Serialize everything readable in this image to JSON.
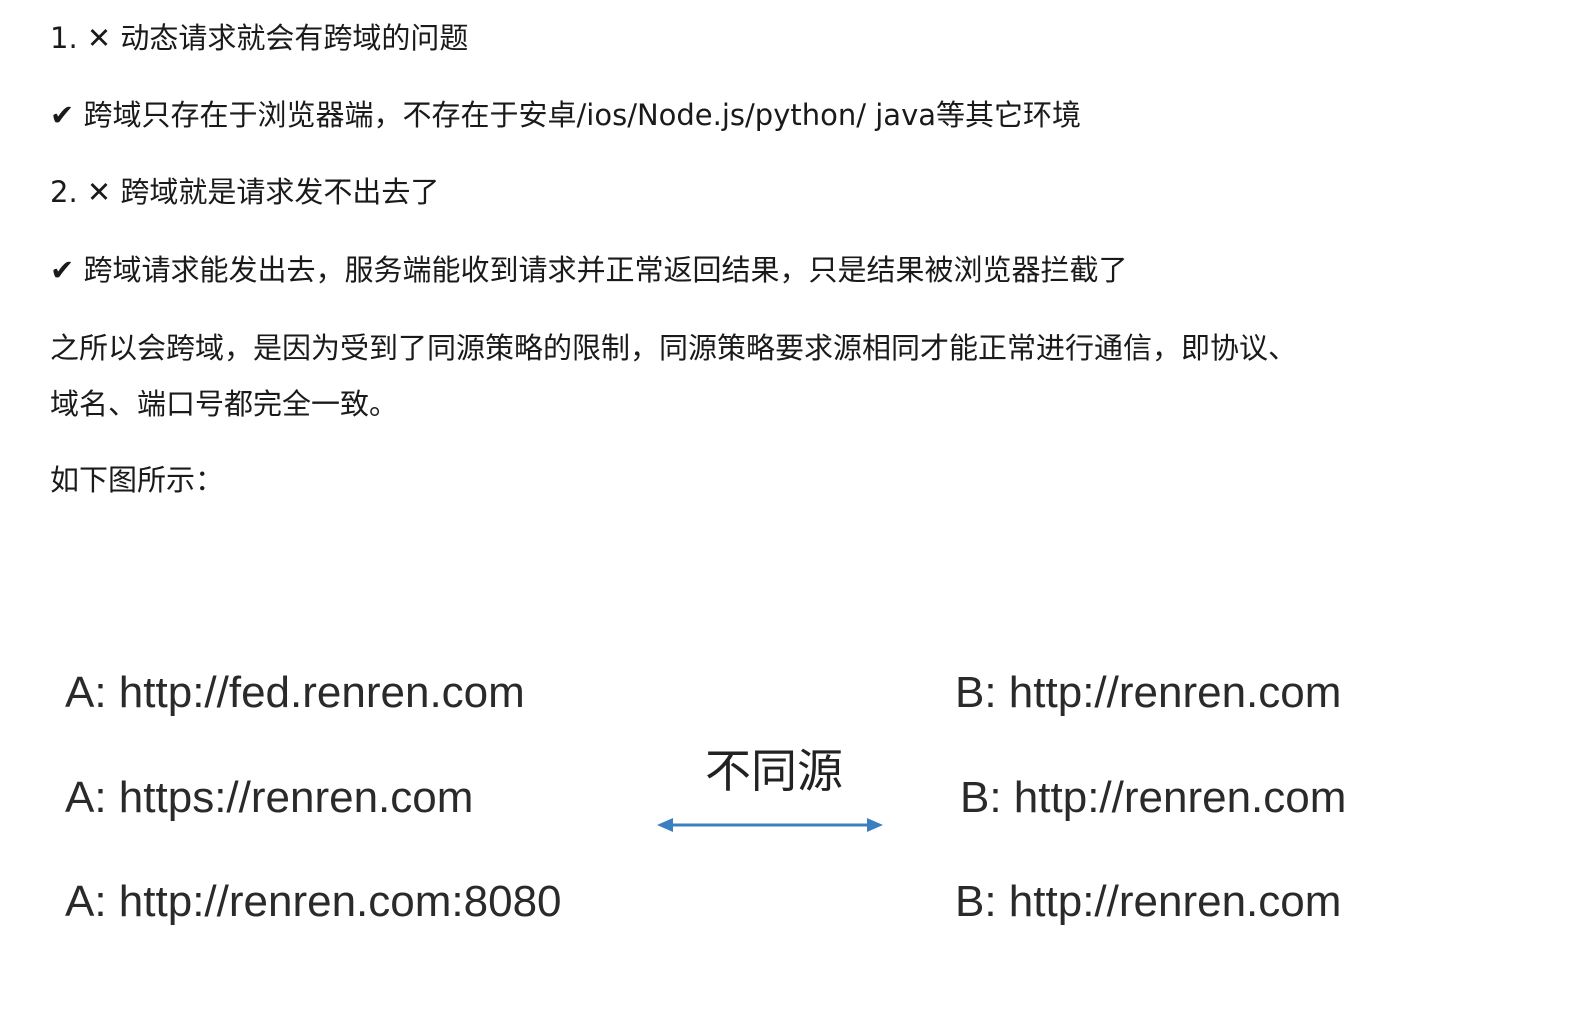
{
  "paragraphs": [
    "1. ✕ 动态请求就会有跨域的问题",
    "✔ 跨域只存在于浏览器端，不存在于安卓/ios/Node.js/python/ java等其它环境",
    "2. ✕ 跨域就是请求发不出去了",
    "✔ 跨域请求能发出去，服务端能收到请求并正常返回结果，只是结果被浏览器拦截了",
    "之所以会跨域，是因为受到了同源策略的限制，同源策略要求源相同才能正常进行通信，即协议、",
    "域名、端口号都完全一致。",
    "如下图所示："
  ],
  "figure": {
    "left": [
      "A: http://fed.renren.com",
      "A: https://renren.com",
      "A: http://renren.com:8080"
    ],
    "right": [
      "B: http://renren.com",
      "B: http://renren.com",
      "B: http://renren.com"
    ],
    "label": "不同源",
    "arrow_color": "#3b7fc0"
  }
}
